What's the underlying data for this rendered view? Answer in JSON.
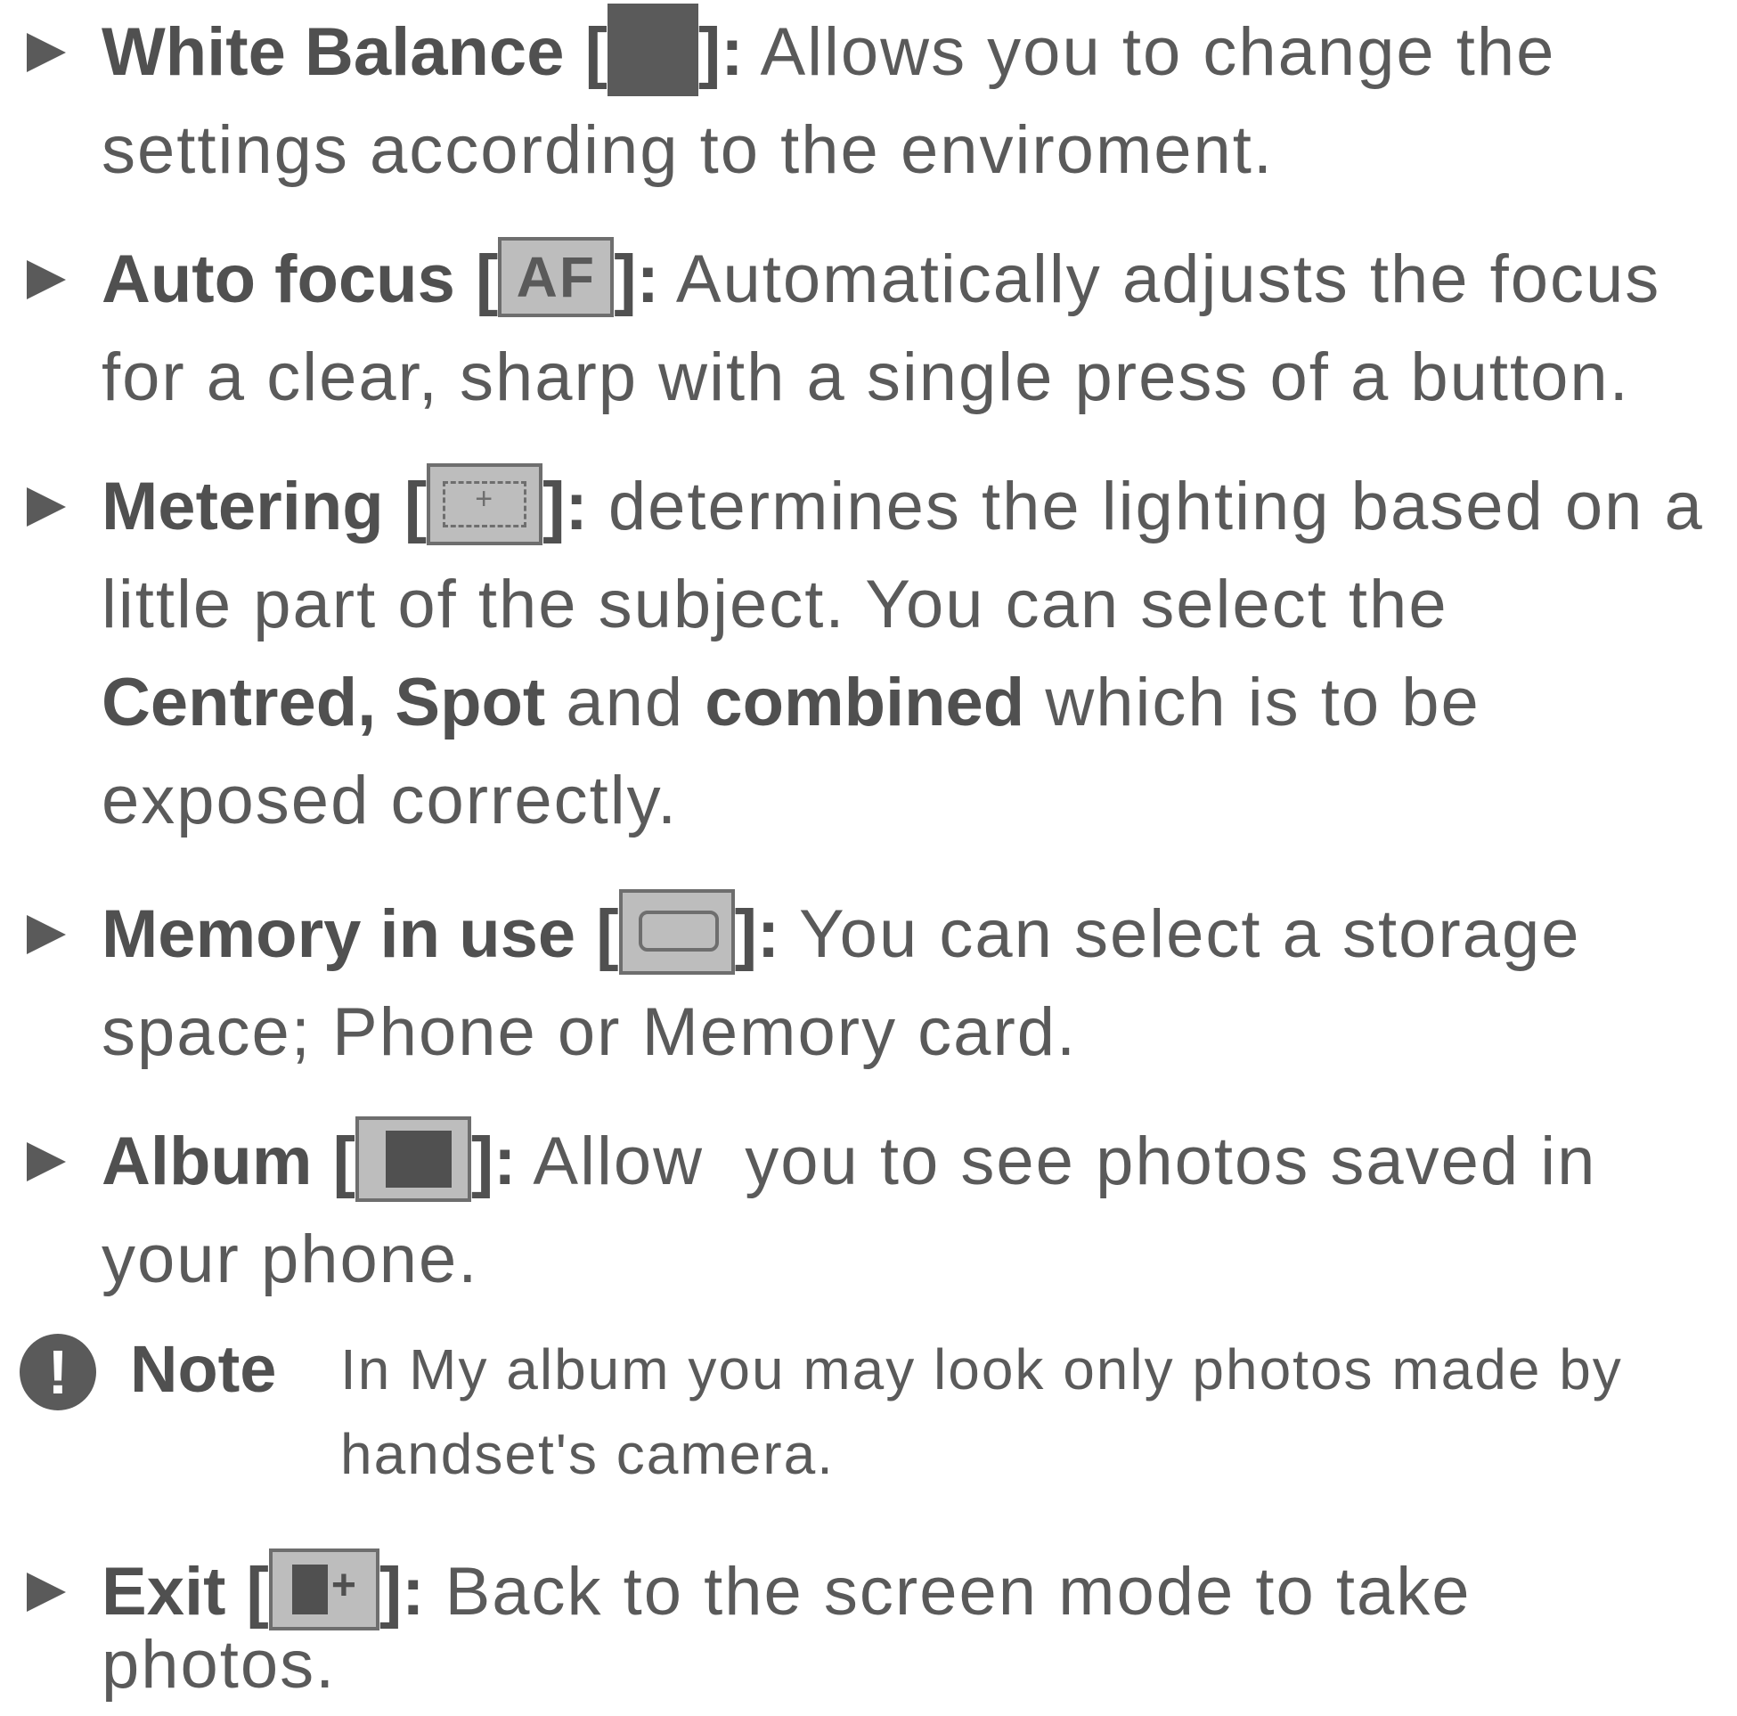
{
  "items": [
    {
      "title": "White Balance",
      "lines": [
        "Allows you to change the",
        "settings according to the enviroment."
      ]
    },
    {
      "title": "Auto focus",
      "icon_text": "AF",
      "lines": [
        "Automatically adjusts the focus",
        "for a clear, sharp with a single press of a button."
      ]
    },
    {
      "title": "Metering",
      "lines": [
        "determines the lighting based on a",
        "little part of the subject. You can select the"
      ],
      "bold_options": [
        "Centred, Spot",
        "combined"
      ],
      "connector": "and",
      "after_options": "which is to be",
      "last_line": "exposed correctly."
    },
    {
      "title": "Memory in use",
      "lines": [
        "You can select a storage",
        "space; Phone or Memory card."
      ]
    },
    {
      "title": "Album",
      "lines": [
        "Allow  you to see photos saved in",
        "your phone."
      ]
    },
    {
      "title": "Exit",
      "lines": [
        "Back to the screen mode to take",
        "photos."
      ]
    }
  ],
  "note": {
    "label": "Note",
    "icon_glyph": "!",
    "lines": [
      "In My album you may look only photos made by",
      "handset's camera."
    ]
  },
  "punct": {
    "open": "[",
    "close": "]:"
  },
  "icons": [
    "white-balance-icon",
    "auto-focus-icon",
    "metering-icon",
    "memory-icon",
    "album-icon",
    "exit-icon",
    "note-icon"
  ]
}
